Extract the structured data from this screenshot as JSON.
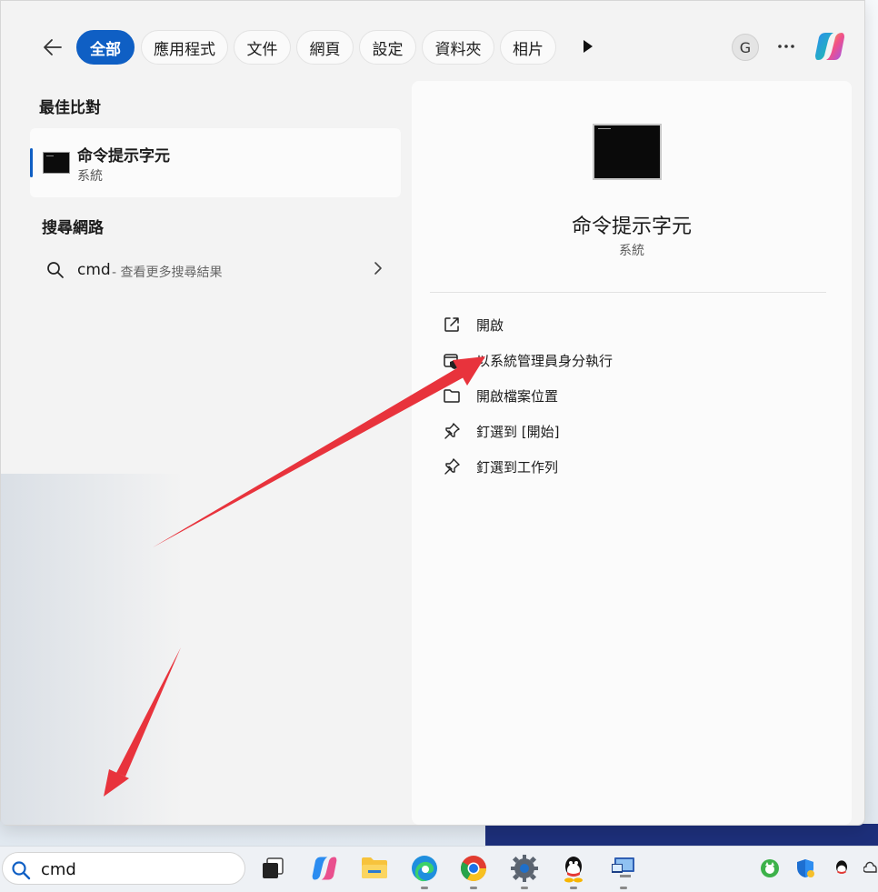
{
  "filters": {
    "back_icon": "back-arrow-icon",
    "tabs": [
      {
        "label": "全部",
        "active": true
      },
      {
        "label": "應用程式",
        "active": false
      },
      {
        "label": "文件",
        "active": false
      },
      {
        "label": "網頁",
        "active": false
      },
      {
        "label": "設定",
        "active": false
      },
      {
        "label": "資料夾",
        "active": false
      },
      {
        "label": "相片",
        "active": false
      }
    ],
    "more_icon": "play-triangle-icon",
    "account_initial": "G",
    "menu_icon": "ellipsis-icon",
    "copilot_icon": "copilot-icon"
  },
  "results": {
    "best_match_title": "最佳比對",
    "best_match": {
      "name": "命令提示字元",
      "type": "系統",
      "icon": "command-prompt-icon"
    },
    "web_title": "搜尋網路",
    "web_item": {
      "query": "cmd",
      "hint": "- 查看更多搜尋結果",
      "icon": "search-icon",
      "chevron": "chevron-right-icon"
    }
  },
  "preview": {
    "name": "命令提示字元",
    "type": "系統",
    "icon": "command-prompt-icon",
    "actions": [
      {
        "label": "開啟",
        "icon": "open-external-icon"
      },
      {
        "label": "以系統管理員身分執行",
        "icon": "shield-admin-icon"
      },
      {
        "label": "開啟檔案位置",
        "icon": "folder-icon"
      },
      {
        "label": "釘選到 [開始]",
        "icon": "pin-icon"
      },
      {
        "label": "釘選到工作列",
        "icon": "pin-icon"
      }
    ]
  },
  "annotations": {
    "arrow_color": "#e8333c"
  },
  "taskbar": {
    "search_value": "cmd",
    "search_icon": "search-icon",
    "apps": [
      {
        "name": "task-view-icon",
        "running": false
      },
      {
        "name": "copilot-icon",
        "running": false
      },
      {
        "name": "file-explorer-icon",
        "running": false
      },
      {
        "name": "edge-icon",
        "running": true
      },
      {
        "name": "chrome-icon",
        "running": true
      },
      {
        "name": "settings-icon",
        "running": true
      },
      {
        "name": "qq-icon",
        "running": true
      },
      {
        "name": "network-computer-icon",
        "running": true
      }
    ],
    "tray": [
      "cat-app-icon",
      "defender-shield-icon",
      "qq-tray-icon",
      "cloud-icon"
    ]
  },
  "colors": {
    "accent": "#0f5fc4",
    "panel_bg": "#f3f3f3",
    "preview_bg": "#fbfbfb"
  }
}
